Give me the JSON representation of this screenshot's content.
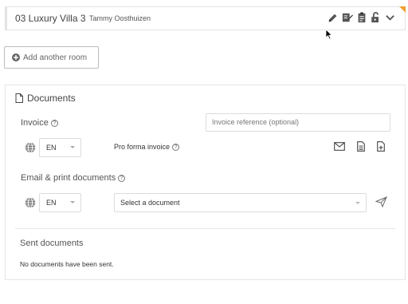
{
  "room": {
    "title": "03 Luxury Villa 3",
    "guest": "Tammy Oosthuizen",
    "icons": [
      "pencil-icon",
      "edit-document-icon",
      "clipboard-icon",
      "unlock-icon",
      "chevron-down-icon"
    ],
    "accent": "#f0a030"
  },
  "add_room": {
    "label": "Add another room",
    "icon": "plus-circle-icon"
  },
  "documents": {
    "title": "Documents",
    "icon": "document-icon",
    "invoice": {
      "label": "Invoice",
      "reference_placeholder": "Invoice reference (optional)",
      "language": "EN",
      "proforma_label": "Pro forma invoice",
      "actions": [
        "email-icon",
        "file-text-icon",
        "file-plus-icon"
      ]
    },
    "email_print": {
      "label": "Email & print documents",
      "language": "EN",
      "select_placeholder": "Select a document",
      "send_icon": "send-icon"
    },
    "sent": {
      "label": "Sent documents",
      "empty_text": "No documents have been sent."
    }
  }
}
